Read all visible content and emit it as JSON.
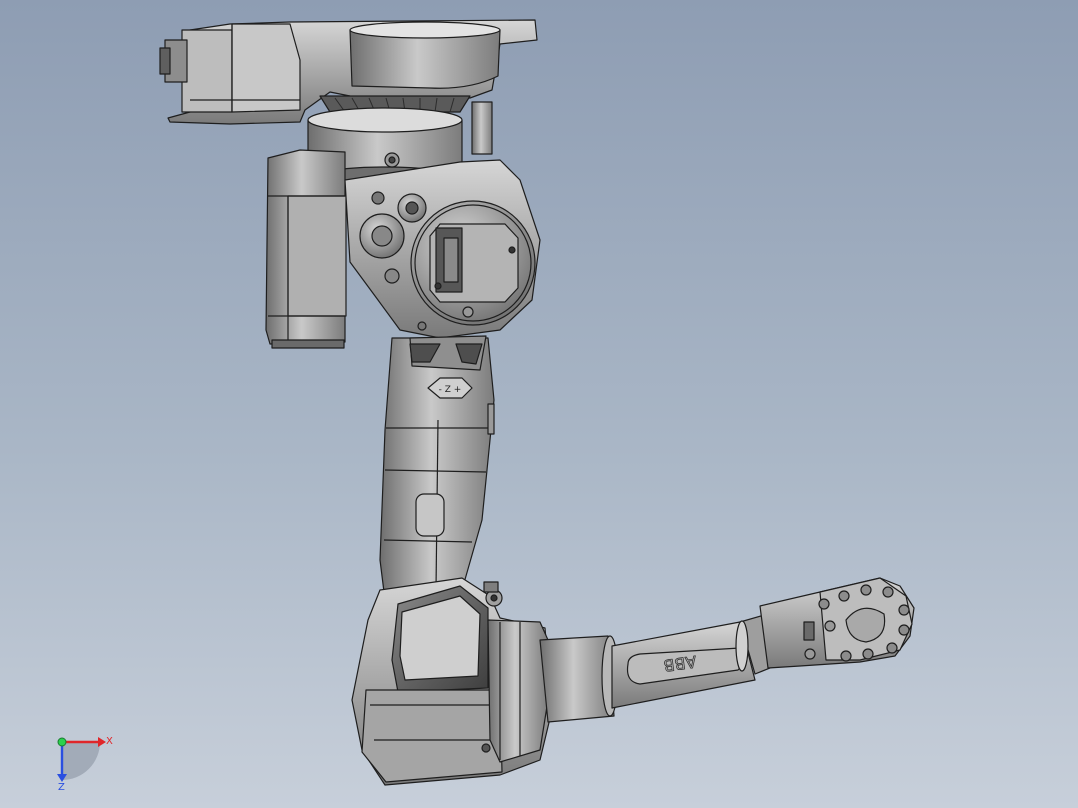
{
  "viewport": {
    "background_top": "#8e9db3",
    "background_bottom": "#c7cfda"
  },
  "model": {
    "engraving_top": "- Z +",
    "logo_text": "ABB"
  },
  "triad": {
    "x_label": "X",
    "z_label": "Z",
    "colors": {
      "x_axis": "#e0262a",
      "y_axis": "#2bd14d",
      "z_axis": "#2a4fe0"
    }
  }
}
